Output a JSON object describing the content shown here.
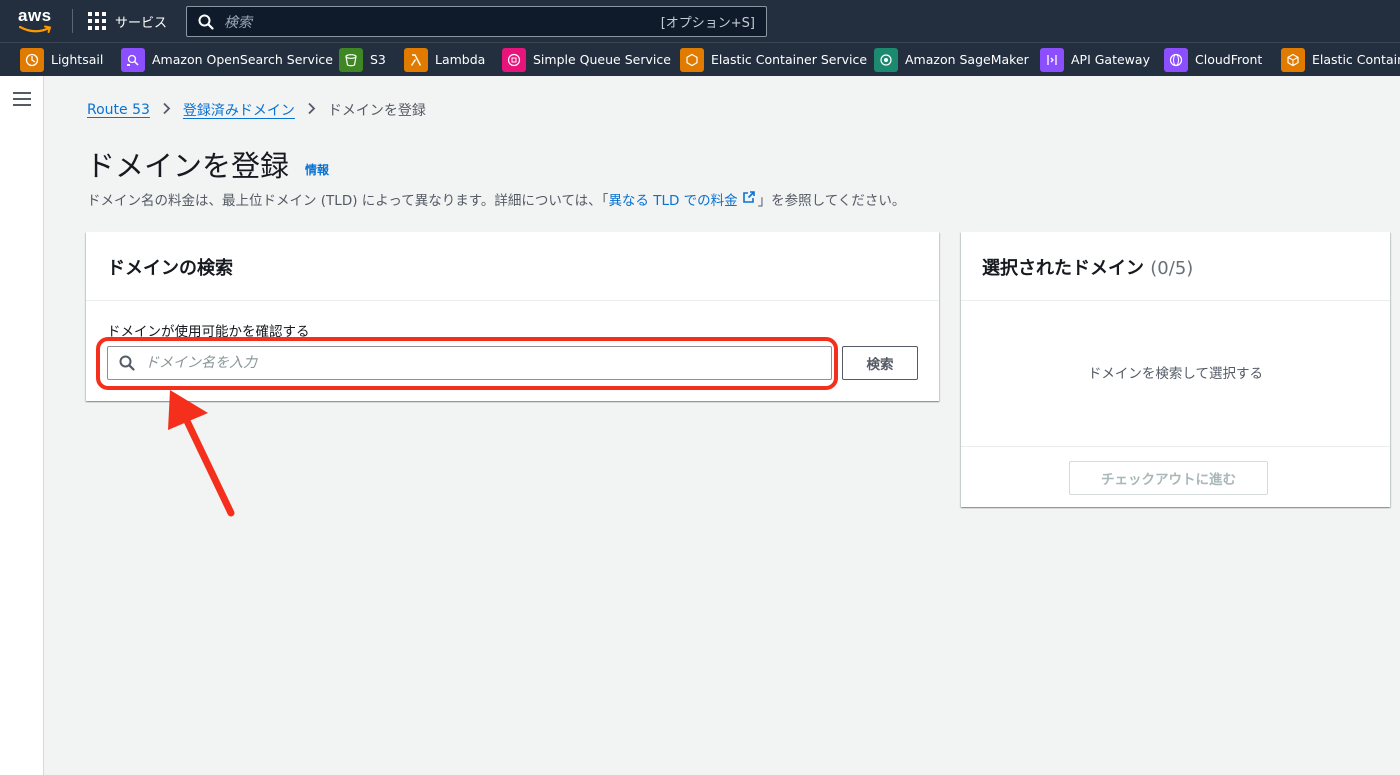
{
  "topbar": {
    "logo_text": "aws",
    "services_label": "サービス",
    "search_placeholder": "検索",
    "search_shortcut": "[オプション+S]"
  },
  "favorites": [
    {
      "label": "Lightsail",
      "icon": "lightsail-icon",
      "color": "#e07b00"
    },
    {
      "label": "Amazon OpenSearch Service",
      "icon": "opensearch-icon",
      "color": "#8c4fff"
    },
    {
      "label": "S3",
      "icon": "s3-bucket-icon",
      "color": "#3f8624"
    },
    {
      "label": "Lambda",
      "icon": "lambda-icon",
      "color": "#e07b00"
    },
    {
      "label": "Simple Queue Service",
      "icon": "sqs-icon",
      "color": "#e7157b"
    },
    {
      "label": "Elastic Container Service",
      "icon": "ecs-icon",
      "color": "#e07b00"
    },
    {
      "label": "Amazon SageMaker",
      "icon": "sagemaker-icon",
      "color": "#1b8a6f"
    },
    {
      "label": "API Gateway",
      "icon": "api-gateway-icon",
      "color": "#8c4fff"
    },
    {
      "label": "CloudFront",
      "icon": "cloudfront-icon",
      "color": "#8c4fff"
    },
    {
      "label": "Elastic Containe",
      "icon": "ecr-icon",
      "color": "#e07b00"
    }
  ],
  "breadcrumb": {
    "root": "Route 53",
    "middle": "登録済みドメイン",
    "current": "ドメインを登録"
  },
  "page": {
    "title": "ドメインを登録",
    "info_link": "情報",
    "desc_before": "ドメイン名の料金は、最上位ドメイン (TLD) によって異なります。詳細については、「",
    "desc_link": "異なる TLD での料金",
    "desc_after": "」を参照してください。"
  },
  "search_panel": {
    "title": "ドメインの検索",
    "field_label": "ドメインが使用可能かを確認する",
    "input_placeholder": "ドメイン名を入力",
    "input_value": "",
    "search_button": "検索"
  },
  "selected_panel": {
    "title": "選択されたドメイン",
    "count": "(0/5)",
    "empty_text": "ドメインを検索して選択する",
    "checkout_button": "チェックアウトに進む"
  },
  "colors": {
    "topbar": "#232f3e",
    "link": "#0972d3",
    "annotation": "#f4301c"
  }
}
